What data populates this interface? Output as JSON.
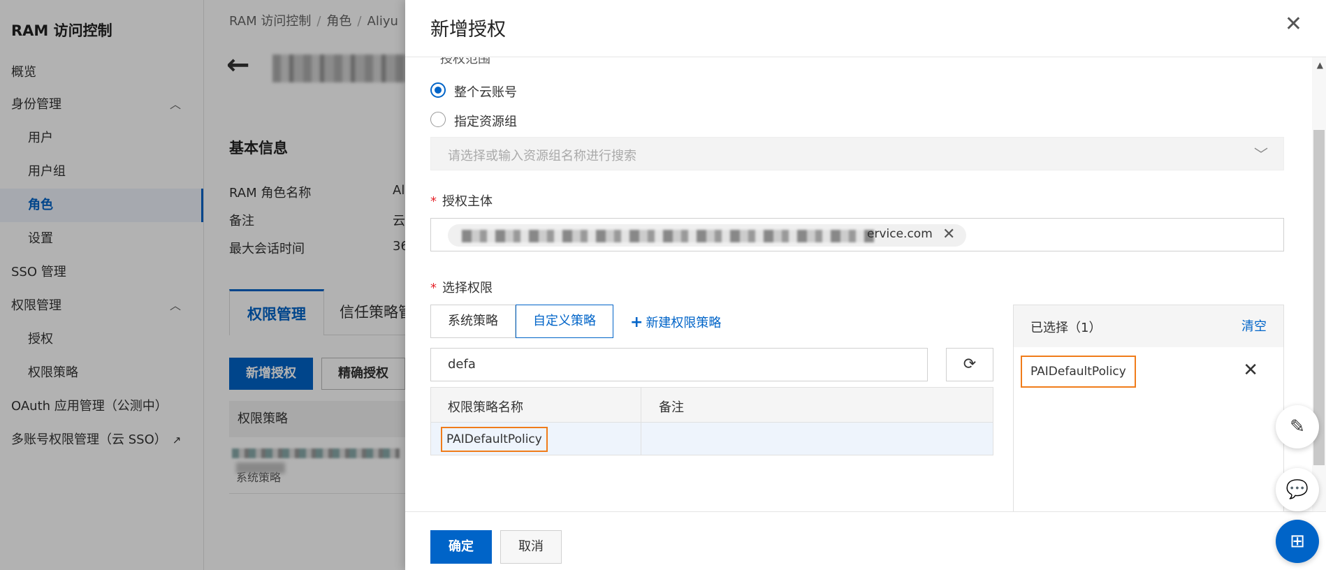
{
  "sidebar": {
    "title": "RAM 访问控制",
    "items": [
      {
        "label": "概览"
      },
      {
        "label": "身份管理"
      },
      {
        "label": "用户"
      },
      {
        "label": "用户组"
      },
      {
        "label": "角色"
      },
      {
        "label": "设置"
      },
      {
        "label": "SSO 管理"
      },
      {
        "label": "权限管理"
      },
      {
        "label": "授权"
      },
      {
        "label": "权限策略"
      },
      {
        "label": "OAuth 应用管理（公测中）"
      },
      {
        "label": "多账号权限管理（云 SSO）"
      }
    ]
  },
  "page": {
    "breadcrumb": [
      "RAM 访问控制",
      "角色",
      "Aliyu"
    ],
    "section_title": "基本信息",
    "info": [
      {
        "label": "RAM 角色名称",
        "value": "Al"
      },
      {
        "label": "备注",
        "value": "云"
      },
      {
        "label": "最大会话时间",
        "value": "36"
      }
    ],
    "tabs": [
      "权限管理",
      "信任策略管"
    ],
    "buttons": {
      "add_grant": "新增授权",
      "precise_grant": "精确授权"
    },
    "table_header": "权限策略",
    "row_type": "系统策略"
  },
  "drawer": {
    "title": "新增授权",
    "scope_label": "授权范围",
    "scope_options": [
      "整个云账号",
      "指定资源组"
    ],
    "resource_group_placeholder": "请选择或输入资源组名称进行搜索",
    "principal_label": "授权主体",
    "principal_value_suffix": "ervice.com",
    "permission_label": "选择权限",
    "policy_tabs": {
      "system": "系统策略",
      "custom": "自定义策略"
    },
    "new_policy": "新建权限策略",
    "search_value": "defa",
    "table_columns": [
      "权限策略名称",
      "备注"
    ],
    "table_rows": [
      {
        "name": "PAIDefaultPolicy",
        "note": ""
      }
    ],
    "selected_title": "已选择（1）",
    "clear_label": "清空",
    "selected_items": [
      "PAIDefaultPolicy"
    ],
    "confirm_label": "确定",
    "cancel_label": "取消"
  },
  "colors": {
    "accent": "#0064c8",
    "highlight": "#f07c1a",
    "required": "#e5242b"
  }
}
